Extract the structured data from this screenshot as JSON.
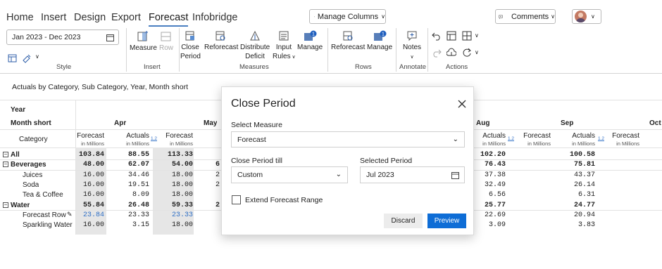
{
  "tabs": [
    {
      "label": "Home"
    },
    {
      "label": "Insert"
    },
    {
      "label": "Design"
    },
    {
      "label": "Export"
    },
    {
      "label": "Forecast"
    },
    {
      "label": "Infobridge"
    }
  ],
  "topbar": {
    "manage_columns": "Manage Columns",
    "comments": "Comments"
  },
  "ribbon": {
    "date_range": "Jan 2023 - Dec 2023",
    "style_label": "Style",
    "insert_group": {
      "label": "Insert",
      "measure": "Measure",
      "row": "Row"
    },
    "measures_group": {
      "label": "Measures",
      "close_period_1": "Close",
      "close_period_2": "Period",
      "reforecast": "Reforecast",
      "distribute_1": "Distribute",
      "distribute_2": "Deficit",
      "input_rules_1": "Input",
      "input_rules_2": "Rules",
      "manage": "Manage",
      "badge": "1"
    },
    "rows_group": {
      "label": "Rows",
      "reforecast": "Reforecast",
      "manage": "Manage",
      "badge": "1"
    },
    "annotate_group": {
      "label": "Annotate",
      "notes": "Notes"
    },
    "actions_group": {
      "label": "Actions"
    }
  },
  "breadcrumb": "Actuals by Category, Sub Category, Year, Month short",
  "grid": {
    "year_label": "Year",
    "month_label": "Month short",
    "category_label": "Category",
    "months": [
      "Apr",
      "May",
      "Aug",
      "Sep",
      "Oct"
    ],
    "forecast_label": "Forecast",
    "actuals_label": "Actuals",
    "unit_label": "in Millions",
    "delta_icon": "1.2",
    "rows": [
      {
        "name": "All",
        "toggle": "−",
        "bold": true,
        "jan_fc": "103.84",
        "apr_act": "88.55",
        "apr_fc": "113.33",
        "may_act": "",
        "aug_act": "102.20",
        "sep_act": "100.58"
      },
      {
        "name": "Beverages",
        "toggle": "−",
        "bold": true,
        "jan_fc": "48.00",
        "apr_act": "62.07",
        "apr_fc": "54.00",
        "may_act": "6",
        "aug_act": "76.43",
        "sep_act": "75.81"
      },
      {
        "name": "Juices",
        "toggle": "",
        "bold": false,
        "jan_fc": "16.00",
        "apr_act": "34.46",
        "apr_fc": "18.00",
        "may_act": "2",
        "aug_act": "37.38",
        "sep_act": "43.37"
      },
      {
        "name": "Soda",
        "toggle": "",
        "bold": false,
        "jan_fc": "16.00",
        "apr_act": "19.51",
        "apr_fc": "18.00",
        "may_act": "2",
        "aug_act": "32.49",
        "sep_act": "26.14"
      },
      {
        "name": "Tea & Coffee",
        "toggle": "",
        "bold": false,
        "jan_fc": "16.00",
        "apr_act": "8.09",
        "apr_fc": "18.00",
        "may_act": "",
        "aug_act": "6.56",
        "sep_act": "6.31"
      },
      {
        "name": "Water",
        "toggle": "−",
        "bold": true,
        "jan_fc": "55.84",
        "apr_act": "26.48",
        "apr_fc": "59.33",
        "may_act": "2",
        "aug_act": "25.77",
        "sep_act": "24.77"
      },
      {
        "name": "Forecast Row",
        "toggle": "",
        "bold": false,
        "blue": true,
        "jan_fc": "23.84",
        "apr_act": "23.33",
        "apr_fc": "23.33",
        "may_act": "",
        "aug_act": "22.69",
        "sep_act": "20.94"
      },
      {
        "name": "Sparkling Water",
        "toggle": "",
        "bold": false,
        "jan_fc": "16.00",
        "apr_act": "3.15",
        "apr_fc": "18.00",
        "may_act": "",
        "aug_act": "3.09",
        "sep_act": "3.83"
      }
    ]
  },
  "modal": {
    "title": "Close Period",
    "select_measure_label": "Select Measure",
    "select_measure_value": "Forecast",
    "close_till_label": "Close Period till",
    "close_till_value": "Custom",
    "selected_period_label": "Selected Period",
    "selected_period_value": "Jul 2023",
    "extend_label": "Extend Forecast Range",
    "discard": "Discard",
    "preview": "Preview"
  },
  "colors": {
    "accent": "#0e6dd6",
    "tab_underline": "#4a7fc1",
    "link_blue": "#2f6fc5",
    "shade": "#e6e6e6"
  }
}
